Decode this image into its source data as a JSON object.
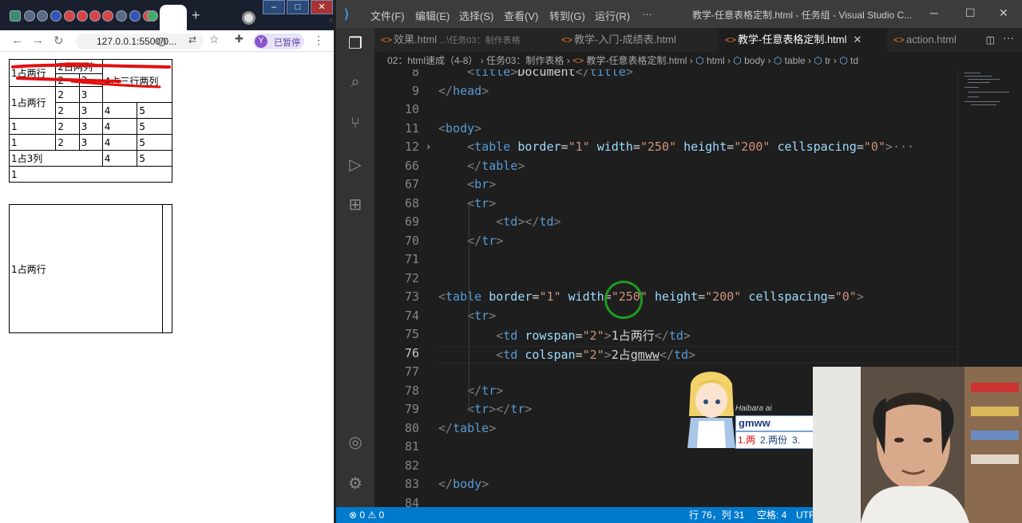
{
  "browser": {
    "tab_close": "×",
    "new_tab": "+",
    "nav": {
      "back": "←",
      "forward": "→",
      "reload": "↻"
    },
    "url": "127.0.0.1:5500/0...",
    "profile_initial": "Y",
    "profile_status": "已暂停",
    "table1": {
      "rows": [
        [
          "1占两行",
          "2占两列",
          "",
          "4占三行两列"
        ],
        [
          "2",
          "3"
        ],
        [
          "1占两行",
          "2",
          "3",
          ""
        ],
        [
          "2",
          "3",
          "4",
          "5"
        ],
        [
          "1",
          "2",
          "3",
          "4",
          "5"
        ],
        [
          "1",
          "2",
          "3",
          "4",
          "5"
        ],
        [
          "1占3列",
          "4",
          "5"
        ],
        [
          "1"
        ]
      ]
    },
    "table2": {
      "cell": "1占两行"
    }
  },
  "vscode": {
    "menu": [
      "文件(F)",
      "编辑(E)",
      "选择(S)",
      "查看(V)",
      "转到(G)",
      "运行(R)",
      "···"
    ],
    "window_title": "教学-任意表格定制.html - 任务组 - Visual Studio C...",
    "tabs": [
      {
        "label": "效果.html",
        "desc": "...\\任务03：制作表格"
      },
      {
        "label": "教学-入门-成绩表.html",
        "desc": ""
      },
      {
        "label": "教学-任意表格定制.html",
        "desc": "",
        "active": true
      },
      {
        "label": "action.html",
        "desc": ""
      }
    ],
    "breadcrumb": [
      "02：html速成（4-8）",
      "任务03：制作表格",
      "教学-任意表格定制.html",
      "html",
      "body",
      "table",
      "tr",
      "td"
    ],
    "lines": [
      {
        "n": "8",
        "html": "<span class='pun'>    &lt;</span><span class='tag'>title</span><span class='pun'>&gt;</span><span class='txt'>Document</span><span class='pun'>&lt;/</span><span class='tag'>title</span><span class='pun'>&gt;</span>"
      },
      {
        "n": "9",
        "html": "<span class='pun'>&lt;/</span><span class='tag'>head</span><span class='pun'>&gt;</span>"
      },
      {
        "n": "10",
        "html": ""
      },
      {
        "n": "11",
        "html": "<span class='pun'>&lt;</span><span class='tag'>body</span><span class='pun'>&gt;</span>"
      },
      {
        "n": "12",
        "html": "<span class='pun'>    &lt;</span><span class='tag'>table</span> <span class='att'>border</span><span class='txt'>=</span><span class='str'>\"1\"</span> <span class='att'>width</span><span class='txt'>=</span><span class='str'>\"250\"</span> <span class='att'>height</span><span class='txt'>=</span><span class='str'>\"200\"</span> <span class='att'>cellspacing</span><span class='txt'>=</span><span class='str'>\"0\"</span><span class='pun'>&gt;</span><span class='pun'>···</span>"
      },
      {
        "n": "66",
        "html": "<span class='pun'>    &lt;/</span><span class='tag'>table</span><span class='pun'>&gt;</span>"
      },
      {
        "n": "67",
        "html": "<span class='pun'>    &lt;</span><span class='tag'>br</span><span class='pun'>&gt;</span>"
      },
      {
        "n": "68",
        "html": "<span class='pun'>    &lt;</span><span class='tag'>tr</span><span class='pun'>&gt;</span>"
      },
      {
        "n": "69",
        "html": "<span class='pun'>        &lt;</span><span class='tag'>td</span><span class='pun'>&gt;&lt;/</span><span class='tag'>td</span><span class='pun'>&gt;</span>"
      },
      {
        "n": "70",
        "html": "<span class='pun'>    &lt;/</span><span class='tag'>tr</span><span class='pun'>&gt;</span>"
      },
      {
        "n": "71",
        "html": ""
      },
      {
        "n": "72",
        "html": ""
      },
      {
        "n": "73",
        "html": "<span class='pun'>&lt;</span><span class='tag'>table</span> <span class='att'>border</span><span class='txt'>=</span><span class='str'>\"1\"</span> <span class='att'>width</span><span class='txt'>=</span><span class='str'>\"250\"</span> <span class='att'>height</span><span class='txt'>=</span><span class='str'>\"200\"</span> <span class='att'>cellspacing</span><span class='txt'>=</span><span class='str'>\"0\"</span><span class='pun'>&gt;</span>"
      },
      {
        "n": "74",
        "html": "<span class='pun'>    &lt;</span><span class='tag'>tr</span><span class='pun'>&gt;</span>"
      },
      {
        "n": "75",
        "html": "<span class='pun'>        &lt;</span><span class='tag'>td</span> <span class='att'>rowspan</span><span class='txt'>=</span><span class='str'>\"2\"</span><span class='pun'>&gt;</span><span class='txt'>1占两行</span><span class='pun'>&lt;/</span><span class='tag'>td</span><span class='pun'>&gt;</span>"
      },
      {
        "n": "76",
        "html": "<span class='pun'>        &lt;</span><span class='tag'>td</span> <span class='att'>colspan</span><span class='txt'>=</span><span class='str'>\"2\"</span><span class='pun'>&gt;</span><span class='txt'>2占<u>gmww</u></span><span class='pun'>&lt;/</span><span class='tag'>td</span><span class='pun'>&gt;</span>",
        "current": true
      },
      {
        "n": "77",
        "html": ""
      },
      {
        "n": "78",
        "html": "<span class='pun'>    &lt;/</span><span class='tag'>tr</span><span class='pun'>&gt;</span>"
      },
      {
        "n": "79",
        "html": "<span class='pun'>    &lt;</span><span class='tag'>tr</span><span class='pun'>&gt;&lt;/</span><span class='tag'>tr</span><span class='pun'>&gt;</span>"
      },
      {
        "n": "80",
        "html": "<span class='pun'>&lt;/</span><span class='tag'>table</span><span class='pun'>&gt;</span>"
      },
      {
        "n": "81",
        "html": ""
      },
      {
        "n": "82",
        "html": ""
      },
      {
        "n": "83",
        "html": "<span class='pun'>&lt;/</span><span class='tag'>body</span><span class='pun'>&gt;</span>"
      },
      {
        "n": "84",
        "html": ""
      }
    ],
    "status": {
      "errors": "⊗ 0 ⚠ 0",
      "position": "行 76，列 31",
      "spaces": "空格: 4",
      "encoding": "UTF"
    },
    "ime": {
      "brand": "Haibara ai",
      "input": "gmww",
      "candidates": [
        "1.两",
        "2.两份",
        "3."
      ]
    }
  }
}
